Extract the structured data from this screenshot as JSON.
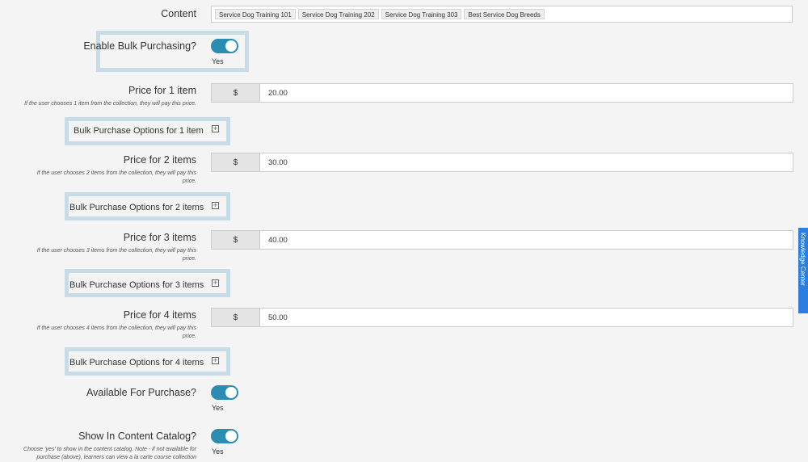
{
  "content": {
    "label": "Content",
    "chips": [
      "Service Dog Training 101",
      "Service Dog Training 202",
      "Service Dog Training 303",
      "Best Service Dog Breeds"
    ]
  },
  "bulk": {
    "label": "Enable Bulk Purchasing?",
    "value": "Yes"
  },
  "currency": "$",
  "prices": [
    {
      "label": "Price for 1 item",
      "help": "If the user chooses 1 item from the collection, they will pay this price.",
      "value": "20.00",
      "options_label": "Bulk Purchase Options for 1 item"
    },
    {
      "label": "Price for 2 items",
      "help": "If the user chooses 2 items from the collection, they will pay this price.",
      "value": "30.00",
      "options_label": "Bulk Purchase Options for 2 items"
    },
    {
      "label": "Price for 3 items",
      "help": "If the user chooses 3 items from the collection, they will pay this price.",
      "value": "40.00",
      "options_label": "Bulk Purchase Options for 3 items"
    },
    {
      "label": "Price for 4 items",
      "help": "If the user chooses 4 items from the collection, they will pay this price.",
      "value": "50.00",
      "options_label": "Bulk Purchase Options for 4 items"
    }
  ],
  "expand_symbol": "+",
  "available": {
    "label": "Available For Purchase?",
    "value": "Yes"
  },
  "catalog": {
    "label": "Show In Content Catalog?",
    "value": "Yes",
    "help": "Choose 'yes' to show in the content catalog. Note - if not available for purchase (above), learners can view a la carte course collection"
  },
  "knowledge_center": {
    "label": "Knowledge Center",
    "icon": "list-icon"
  },
  "colors": {
    "toggle": "#2a8db1",
    "highlight": "#c8dce8",
    "tab": "#2a7ee0"
  }
}
